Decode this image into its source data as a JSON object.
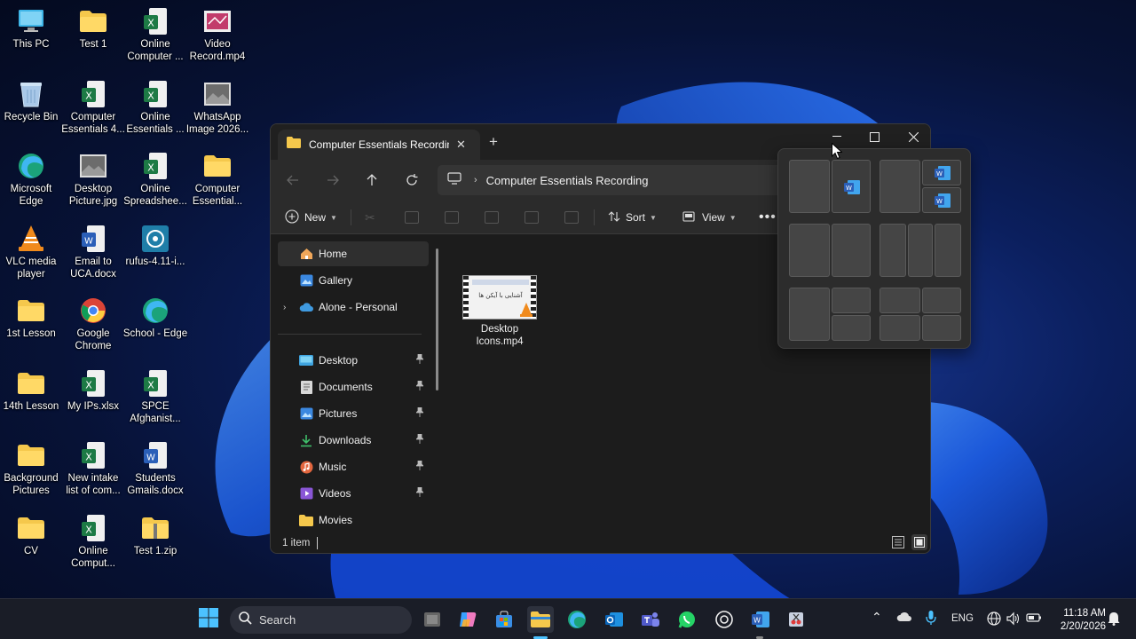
{
  "desktop": {
    "icons": [
      {
        "label": "This PC",
        "icon": "monitor-icon"
      },
      {
        "label": "Test 1",
        "icon": "folder-icon"
      },
      {
        "label": "Online Computer ...",
        "icon": "excel-icon"
      },
      {
        "label": "Video Record.mp4",
        "icon": "video-file-icon"
      },
      {
        "label": "Recycle Bin",
        "icon": "recycle-bin-icon"
      },
      {
        "label": "Computer Essentials 4...",
        "icon": "excel-icon"
      },
      {
        "label": "Online Essentials ...",
        "icon": "excel-icon"
      },
      {
        "label": "WhatsApp Image 2026...",
        "icon": "image-file-icon"
      },
      {
        "label": "Microsoft Edge",
        "icon": "edge-icon"
      },
      {
        "label": "Desktop Picture.jpg",
        "icon": "image-file-icon"
      },
      {
        "label": "Online Spreadshee...",
        "icon": "excel-icon"
      },
      {
        "label": "Computer Essential...",
        "icon": "folder-icon"
      },
      {
        "label": "VLC media player",
        "icon": "vlc-icon"
      },
      {
        "label": "Email to UCA.docx",
        "icon": "word-icon"
      },
      {
        "label": "rufus-4.11-i...",
        "icon": "rufus-icon"
      },
      {
        "label": "1st Lesson",
        "icon": "folder-icon"
      },
      {
        "label": "Google Chrome",
        "icon": "chrome-icon"
      },
      {
        "label": "School - Edge",
        "icon": "edge-icon"
      },
      {
        "label": "14th Lesson",
        "icon": "folder-icon"
      },
      {
        "label": "My IPs.xlsx",
        "icon": "excel-icon"
      },
      {
        "label": "SPCE Afghanist...",
        "icon": "excel-icon"
      },
      {
        "label": "Background Pictures",
        "icon": "folder-icon"
      },
      {
        "label": "New intake list of com...",
        "icon": "excel-icon"
      },
      {
        "label": "Students Gmails.docx",
        "icon": "word-icon"
      },
      {
        "label": "CV",
        "icon": "folder-icon"
      },
      {
        "label": "Online Comput...",
        "icon": "excel-icon"
      },
      {
        "label": "Test 1.zip",
        "icon": "zip-folder-icon"
      }
    ]
  },
  "window": {
    "tab_title": "Computer Essentials Recordin",
    "breadcrumb": "Computer Essentials Recording",
    "commands": {
      "new_label": "New",
      "sort_label": "Sort",
      "view_label": "View"
    },
    "nav": {
      "home": "Home",
      "gallery": "Gallery",
      "onedrive": "Alone - Personal",
      "pinned": [
        "Desktop",
        "Documents",
        "Pictures",
        "Downloads",
        "Music",
        "Videos"
      ],
      "movies": "Movies"
    },
    "files": [
      {
        "name": "Desktop Icons.mp4",
        "thumb_text": "آشنایی با آیکن ها"
      }
    ],
    "status": "1 item"
  },
  "snap_layouts": {
    "app_icon": "word-icon"
  },
  "taskbar": {
    "search_placeholder": "Search",
    "language": "ENG",
    "time": "11:18 AM",
    "date": "2/20/2026"
  },
  "colors": {
    "accent": "#4cc2ff",
    "folder": "#f5c84c",
    "excel": "#1d7a45",
    "word": "#2b5fb8"
  }
}
